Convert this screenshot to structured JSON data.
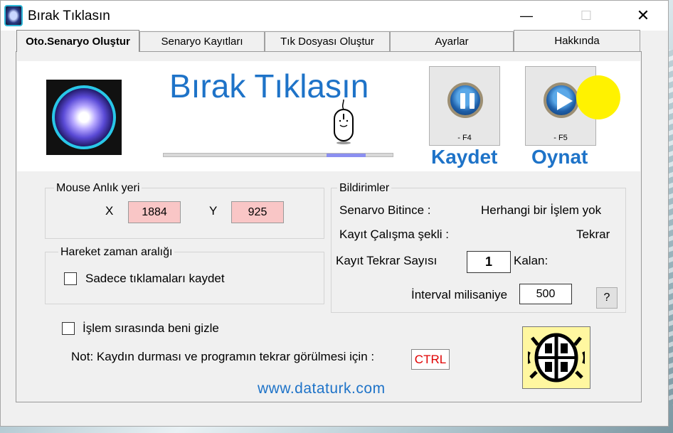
{
  "window": {
    "title": "Bırak Tıklasın"
  },
  "window_controls": {
    "minimize": "—",
    "maximize": "☐",
    "close": "✕"
  },
  "tabs": [
    {
      "label": "Oto.Senaryo Oluştur",
      "active": true
    },
    {
      "label": "Senaryo Kayıtları",
      "active": false
    },
    {
      "label": "Tık Dosyası Oluştur",
      "active": false
    },
    {
      "label": "Ayarlar",
      "active": false
    },
    {
      "label": "Hakkında",
      "active": false
    }
  ],
  "banner": {
    "brand_title": "Bırak Tıklasın",
    "progress_fraction": 0.17
  },
  "record_button": {
    "icon": "pause-icon",
    "key": "- F4",
    "label": "Kaydet"
  },
  "play_button": {
    "icon": "play-icon",
    "key": "- F5",
    "label": "Oynat"
  },
  "mouse_position": {
    "title": "Mouse Anlık yeri",
    "x_label": "X",
    "x_value": "1884",
    "y_label": "Y",
    "y_value": "925"
  },
  "timing": {
    "title": "Hareket zaman aralığı",
    "clicks_only_label": "Sadece tıklamaları kaydet",
    "clicks_only_checked": false
  },
  "notifications": {
    "title": "Bildirimler",
    "scenario_end_label": "Senarvo Bitince :",
    "scenario_end_value": "Herhangi bir İşlem yok",
    "record_mode_label": "Kayıt Çalışma şekli :",
    "record_mode_value": "Tekrar",
    "repeat_count_label": "Kayıt Tekrar Sayısı",
    "repeat_count_value": "1",
    "remaining_label": "Kalan:",
    "interval_label": "İnterval milisaniye",
    "interval_value": "500",
    "help_label": "?"
  },
  "hide_option": {
    "label": "İşlem sırasında beni gizle",
    "checked": false
  },
  "note": {
    "text": "Not: Kaydın durması ve programın tekrar görülmesi için :",
    "key": "CTRL"
  },
  "website": "www.dataturk.com",
  "colors": {
    "accent": "#1e73c8",
    "coord_bg": "#f9c6c6",
    "highlight": "#fff200"
  }
}
